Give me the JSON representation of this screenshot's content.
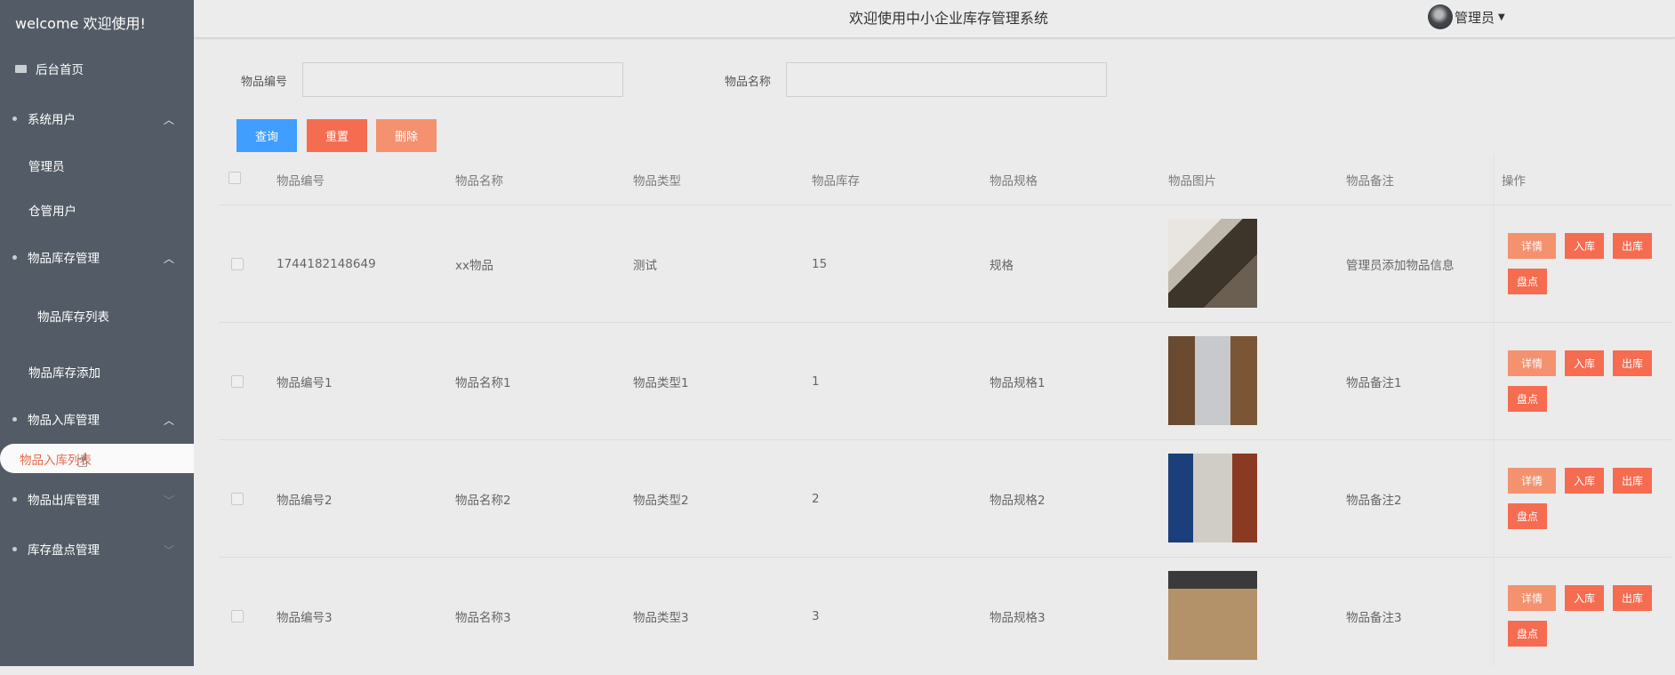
{
  "sidebar": {
    "welcome": "welcome 欢迎使用!",
    "home": "后台首页",
    "groups": [
      {
        "label": "系统用户",
        "items": [
          "管理员",
          "仓管用户"
        ]
      },
      {
        "label": "物品库存管理",
        "items": [
          "物品库存列表",
          "物品库存添加"
        ]
      },
      {
        "label": "物品入库管理",
        "items": [
          "物品入库列表"
        ]
      },
      {
        "label": "物品出库管理",
        "items": []
      },
      {
        "label": "库存盘点管理",
        "items": []
      }
    ]
  },
  "header": {
    "title": "欢迎使用中小企业库存管理系统",
    "user": "管理员"
  },
  "search": {
    "code_label": "物品编号",
    "code_value": "",
    "name_label": "物品名称",
    "name_value": "",
    "query_btn": "查询",
    "reset_btn": "重置",
    "delete_btn": "删除"
  },
  "table": {
    "columns": [
      "物品编号",
      "物品名称",
      "物品类型",
      "物品库存",
      "物品规格",
      "物品图片",
      "物品备注",
      "操作"
    ],
    "actions": [
      "详情",
      "入库",
      "出库",
      "盘点"
    ],
    "rows": [
      {
        "code": "1744182148649",
        "name": "xx物品",
        "type": "测试",
        "stock": "15",
        "spec": "规格",
        "remark": "管理员添加物品信息",
        "image": "bag-photo"
      },
      {
        "code": "物品编号1",
        "name": "物品名称1",
        "type": "物品类型1",
        "stock": "1",
        "spec": "物品规格1",
        "remark": "物品备注1",
        "image": "warehouse-photo"
      },
      {
        "code": "物品编号2",
        "name": "物品名称2",
        "type": "物品类型2",
        "stock": "2",
        "spec": "物品规格2",
        "remark": "物品备注2",
        "image": "warehouse-photo"
      },
      {
        "code": "物品编号3",
        "name": "物品名称3",
        "type": "物品类型3",
        "stock": "3",
        "spec": "物品规格3",
        "remark": "物品备注3",
        "image": "warehouse-photo"
      }
    ]
  },
  "colors": {
    "sidebar_bg": "#535c66",
    "primary_blue": "#409eff",
    "action_red": "#f56c51",
    "action_pink": "#f4916f",
    "active_text": "#e46a4a"
  }
}
